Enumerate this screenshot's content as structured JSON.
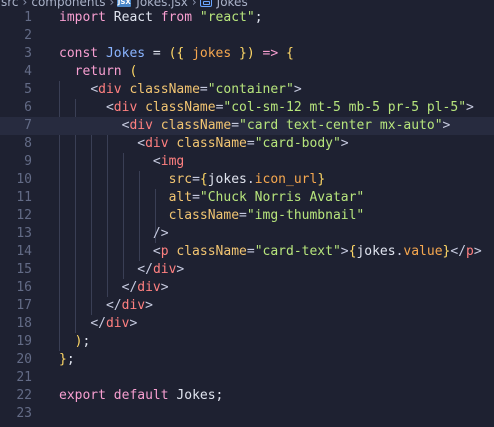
{
  "breadcrumb": {
    "items": [
      "src",
      "components",
      "Jokes.jsx",
      "Jokes"
    ],
    "file_icon": "jsx-file-icon",
    "symbol_icon": "symbol-icon"
  },
  "editor": {
    "lines": [
      {
        "n": "1",
        "tokens": [
          [
            "kw",
            "import"
          ],
          [
            "plain",
            " React "
          ],
          [
            "kw",
            "from"
          ],
          [
            "plain",
            " "
          ],
          [
            "str",
            "\"react\""
          ],
          [
            "plain",
            ";"
          ]
        ]
      },
      {
        "n": "2",
        "tokens": []
      },
      {
        "n": "3",
        "tokens": [
          [
            "kw",
            "const"
          ],
          [
            "plain",
            " "
          ],
          [
            "fn",
            "Jokes"
          ],
          [
            "plain",
            " = "
          ],
          [
            "br",
            "("
          ],
          [
            "br",
            "{ "
          ],
          [
            "var",
            "jokes"
          ],
          [
            "br",
            " }"
          ],
          [
            "br",
            ")"
          ],
          [
            "kw",
            " =>"
          ],
          [
            "br",
            " {"
          ]
        ]
      },
      {
        "n": "4",
        "tokens": [
          [
            "plain",
            "  "
          ],
          [
            "kw",
            "return"
          ],
          [
            "plain",
            " "
          ],
          [
            "br",
            "("
          ]
        ]
      },
      {
        "n": "5",
        "tokens": [
          [
            "plain",
            "    "
          ],
          [
            "punc",
            "<"
          ],
          [
            "tag",
            "div"
          ],
          [
            "plain",
            " "
          ],
          [
            "attr",
            "className"
          ],
          [
            "punc",
            "="
          ],
          [
            "str",
            "\"container\""
          ],
          [
            "punc",
            ">"
          ]
        ]
      },
      {
        "n": "6",
        "tokens": [
          [
            "plain",
            "      "
          ],
          [
            "punc",
            "<"
          ],
          [
            "tag",
            "div"
          ],
          [
            "plain",
            " "
          ],
          [
            "attr",
            "className"
          ],
          [
            "punc",
            "="
          ],
          [
            "str",
            "\"col-sm-12 mt-5 mb-5 pr-5 pl-5\""
          ],
          [
            "punc",
            ">"
          ]
        ]
      },
      {
        "n": "7",
        "tokens": [
          [
            "plain",
            "        "
          ],
          [
            "punc",
            "<"
          ],
          [
            "tag",
            "div"
          ],
          [
            "plain",
            " "
          ],
          [
            "attr",
            "className"
          ],
          [
            "punc",
            "="
          ],
          [
            "str",
            "\"card text-center mx-auto\""
          ],
          [
            "punc",
            ">"
          ]
        ]
      },
      {
        "n": "8",
        "tokens": [
          [
            "plain",
            "          "
          ],
          [
            "punc",
            "<"
          ],
          [
            "tag",
            "div"
          ],
          [
            "plain",
            " "
          ],
          [
            "attr",
            "className"
          ],
          [
            "punc",
            "="
          ],
          [
            "str",
            "\"card-body\""
          ],
          [
            "punc",
            ">"
          ]
        ]
      },
      {
        "n": "9",
        "tokens": [
          [
            "plain",
            "            "
          ],
          [
            "punc",
            "<"
          ],
          [
            "tag",
            "img"
          ]
        ]
      },
      {
        "n": "10",
        "tokens": [
          [
            "plain",
            "              "
          ],
          [
            "attr",
            "src"
          ],
          [
            "punc",
            "="
          ],
          [
            "br",
            "{"
          ],
          [
            "plain",
            "jokes"
          ],
          [
            "punc",
            "."
          ],
          [
            "prop",
            "icon_url"
          ],
          [
            "br",
            "}"
          ]
        ]
      },
      {
        "n": "11",
        "tokens": [
          [
            "plain",
            "              "
          ],
          [
            "attr",
            "alt"
          ],
          [
            "punc",
            "="
          ],
          [
            "str",
            "\"Chuck Norris Avatar\""
          ]
        ]
      },
      {
        "n": "12",
        "tokens": [
          [
            "plain",
            "              "
          ],
          [
            "attr",
            "className"
          ],
          [
            "punc",
            "="
          ],
          [
            "str",
            "\"img-thumbnail\""
          ]
        ]
      },
      {
        "n": "13",
        "tokens": [
          [
            "plain",
            "            "
          ],
          [
            "punc",
            "/>"
          ]
        ]
      },
      {
        "n": "14",
        "tokens": [
          [
            "plain",
            "            "
          ],
          [
            "punc",
            "<"
          ],
          [
            "tag",
            "p"
          ],
          [
            "plain",
            " "
          ],
          [
            "attr",
            "className"
          ],
          [
            "punc",
            "="
          ],
          [
            "str",
            "\"card-text\""
          ],
          [
            "punc",
            ">"
          ],
          [
            "br",
            "{"
          ],
          [
            "plain",
            "jokes"
          ],
          [
            "punc",
            "."
          ],
          [
            "prop",
            "value"
          ],
          [
            "br",
            "}"
          ],
          [
            "punc",
            "</"
          ],
          [
            "tag",
            "p"
          ],
          [
            "punc",
            ">"
          ]
        ]
      },
      {
        "n": "15",
        "tokens": [
          [
            "plain",
            "          "
          ],
          [
            "punc",
            "</"
          ],
          [
            "tag",
            "div"
          ],
          [
            "punc",
            ">"
          ]
        ]
      },
      {
        "n": "16",
        "tokens": [
          [
            "plain",
            "        "
          ],
          [
            "punc",
            "</"
          ],
          [
            "tag",
            "div"
          ],
          [
            "punc",
            ">"
          ]
        ]
      },
      {
        "n": "17",
        "tokens": [
          [
            "plain",
            "      "
          ],
          [
            "punc",
            "</"
          ],
          [
            "tag",
            "div"
          ],
          [
            "punc",
            ">"
          ]
        ]
      },
      {
        "n": "18",
        "tokens": [
          [
            "plain",
            "    "
          ],
          [
            "punc",
            "</"
          ],
          [
            "tag",
            "div"
          ],
          [
            "punc",
            ">"
          ]
        ]
      },
      {
        "n": "19",
        "tokens": [
          [
            "plain",
            "  "
          ],
          [
            "br",
            ")"
          ],
          [
            "plain",
            ";"
          ]
        ]
      },
      {
        "n": "20",
        "tokens": [
          [
            "br",
            "}"
          ],
          [
            "plain",
            ";"
          ]
        ]
      },
      {
        "n": "21",
        "tokens": []
      },
      {
        "n": "22",
        "tokens": [
          [
            "kw",
            "export"
          ],
          [
            "plain",
            " "
          ],
          [
            "kw",
            "default"
          ],
          [
            "plain",
            " Jokes;"
          ]
        ]
      },
      {
        "n": "23",
        "tokens": []
      }
    ]
  }
}
